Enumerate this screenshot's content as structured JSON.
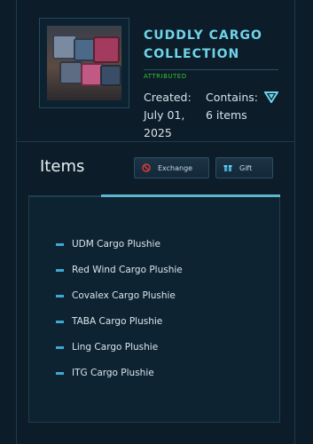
{
  "collection": {
    "title": "CUDDLY CARGO COLLECTION",
    "attribution": "ATTRIBUTED",
    "created_label": "Created: July 01, 2025",
    "contains_label": "Contains: 6 items"
  },
  "actions": {
    "exchange_label": "Exchange",
    "gift_label": "Gift"
  },
  "items_section": {
    "heading": "Items",
    "items": [
      "UDM Cargo Plushie",
      "Red Wind Cargo Plushie",
      "Covalex Cargo Plushie",
      "TABA Cargo Plushie",
      "Ling Cargo Plushie",
      "ITG Cargo Plushie"
    ]
  },
  "colors": {
    "background": "#0c1c28",
    "accent": "#6fd3e8",
    "attributed": "#35c23a",
    "bullet": "#3fa8d4"
  },
  "icons": {
    "exchange": "no-entry-icon",
    "gift": "gift-box-icon",
    "chevron": "chevron-down-icon"
  }
}
